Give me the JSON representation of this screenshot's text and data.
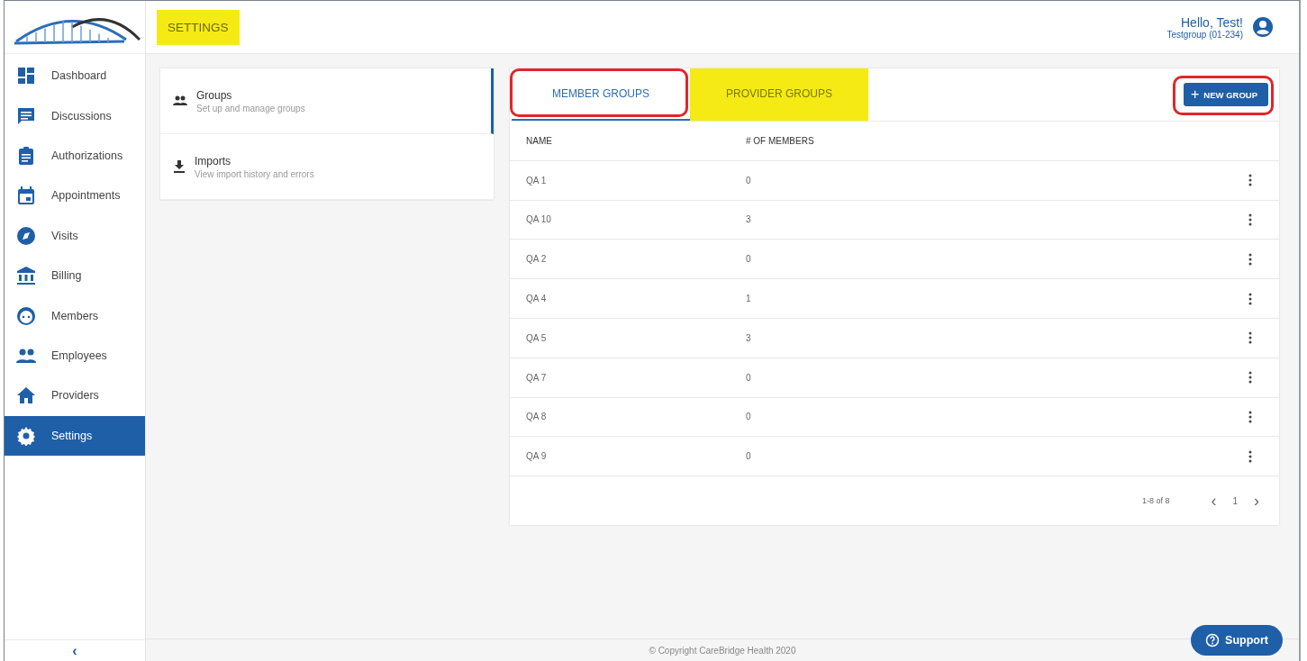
{
  "header": {
    "title": "SETTINGS",
    "title_highlighted": true,
    "greeting": "Hello, Test!",
    "account": "Testgroup (01-234)"
  },
  "sidebar": {
    "items": [
      {
        "label": "Dashboard",
        "selected": false
      },
      {
        "label": "Discussions",
        "selected": false
      },
      {
        "label": "Authorizations",
        "selected": false
      },
      {
        "label": "Appointments",
        "selected": false
      },
      {
        "label": "Visits",
        "selected": false
      },
      {
        "label": "Billing",
        "selected": false
      },
      {
        "label": "Members",
        "selected": false
      },
      {
        "label": "Employees",
        "selected": false
      },
      {
        "label": "Providers",
        "selected": false
      },
      {
        "label": "Settings",
        "selected": true
      }
    ],
    "collapse": "‹"
  },
  "settings_menu": [
    {
      "title": "Groups",
      "subtitle": "Set up and manage groups",
      "selected": true
    },
    {
      "title": "Imports",
      "subtitle": "View import history and errors",
      "selected": false
    }
  ],
  "tabs": [
    {
      "label": "MEMBER GROUPS",
      "selected": true,
      "circled": true,
      "highlighted": false
    },
    {
      "label": "PROVIDER GROUPS",
      "selected": false,
      "circled": false,
      "highlighted": true
    }
  ],
  "new_group_button": {
    "label": "NEW GROUP",
    "icon": "+",
    "circled": true
  },
  "table": {
    "columns": [
      "NAME",
      "# OF MEMBERS"
    ],
    "rows": [
      [
        "QA 1",
        "0"
      ],
      [
        "QA 10",
        "3"
      ],
      [
        "QA 2",
        "0"
      ],
      [
        "QA 4",
        "1"
      ],
      [
        "QA 5",
        "3"
      ],
      [
        "QA 7",
        "0"
      ],
      [
        "QA 8",
        "0"
      ],
      [
        "QA 9",
        "0"
      ]
    ]
  },
  "pagination": {
    "range": "1-8 of 8",
    "prev": "‹",
    "page": "1",
    "next": "›"
  },
  "footer": "© Copyright CareBridge Health 2020",
  "support_button": "Support"
}
